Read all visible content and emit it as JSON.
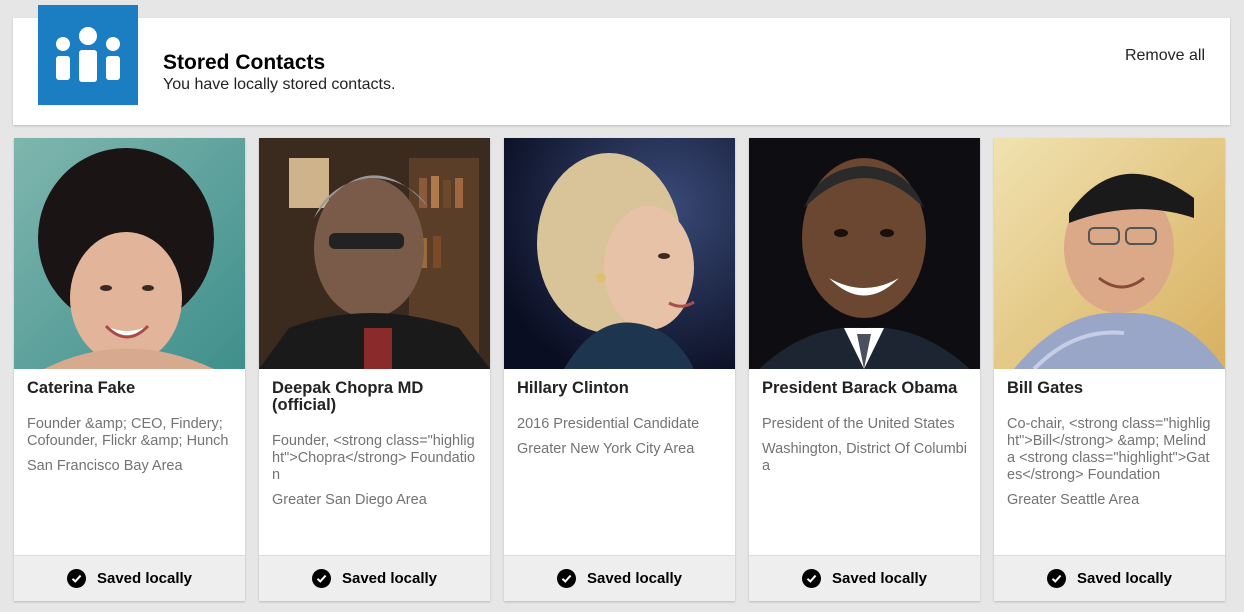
{
  "header": {
    "title": "Stored Contacts",
    "subtitle": "You have locally stored contacts.",
    "remove_all_label": "Remove all",
    "logo_icon": "people-group-icon",
    "brand_color": "#1b7ec2"
  },
  "contacts": [
    {
      "name": "Caterina Fake",
      "headline": "Founder &amp; CEO, Findery; Cofounder, Flickr &amp; Hunch",
      "location": "San Francisco Bay Area",
      "saved_label": "Saved locally"
    },
    {
      "name": "Deepak Chopra MD (official)",
      "headline": "Founder, <strong class=\"highlight\">Chopra</strong> Foundation",
      "location": "Greater San Diego Area",
      "saved_label": "Saved locally"
    },
    {
      "name": "Hillary Clinton",
      "headline": "2016 Presidential Candidate",
      "location": "Greater New York City Area",
      "saved_label": "Saved locally"
    },
    {
      "name": "President Barack Obama",
      "headline": "President of the United States",
      "location": "Washington, District Of Columbia",
      "saved_label": "Saved locally"
    },
    {
      "name": "Bill Gates",
      "headline": "Co-chair, <strong class=\"highlight\">Bill</strong> &amp; Melinda <strong class=\"highlight\">Gates</strong> Foundation",
      "location": "Greater Seattle Area",
      "saved_label": "Saved locally"
    }
  ]
}
